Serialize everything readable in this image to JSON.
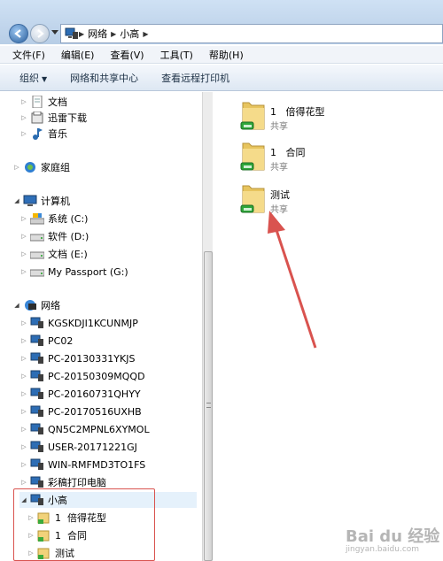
{
  "address": {
    "segments": [
      "网络",
      "小高"
    ]
  },
  "menu": [
    "文件(F)",
    "编辑(E)",
    "查看(V)",
    "工具(T)",
    "帮助(H)"
  ],
  "toolbar": {
    "organize": "组织",
    "network_sharing": "网络和共享中心",
    "printers": "查看远程打印机"
  },
  "nav": {
    "libraries": [
      {
        "label": "文档",
        "icon": "document-icon"
      },
      {
        "label": "迅雷下载",
        "icon": "library-icon"
      },
      {
        "label": "音乐",
        "icon": "music-icon"
      }
    ],
    "homegroup": "家庭组",
    "computer": "计算机",
    "drives": [
      {
        "label": "系统 (C:)",
        "icon": "system-drive-icon"
      },
      {
        "label": "软件 (D:)",
        "icon": "drive-icon"
      },
      {
        "label": "文档 (E:)",
        "icon": "drive-icon"
      },
      {
        "label": "My Passport (G:)",
        "icon": "drive-icon"
      }
    ],
    "network": "网络",
    "computers": [
      "KGSKDJI1KCUNMJP",
      "PC02",
      "PC-20130331YKJS",
      "PC-20150309MQQD",
      "PC-20160731QHYY",
      "PC-20170516UXHB",
      "QN5C2MPNL6XYMOL",
      "USER-20171221GJ",
      "WIN-RMFMD3TO1FS",
      "彩稿打印电脑"
    ],
    "selected_computer": "小高",
    "shares": [
      "1  倍得花型",
      "1  合同",
      "测试"
    ]
  },
  "content": {
    "folders": [
      {
        "name": "1   倍得花型",
        "sub": "共享"
      },
      {
        "name": "1   合同",
        "sub": "共享"
      },
      {
        "name": "测试",
        "sub": "共享"
      }
    ]
  },
  "watermark": {
    "text": "Bai du 经验",
    "sub": "jingyan.baidu.com"
  },
  "colors": {
    "annotation": "#d9534f",
    "accent": "#3c6aa0"
  }
}
